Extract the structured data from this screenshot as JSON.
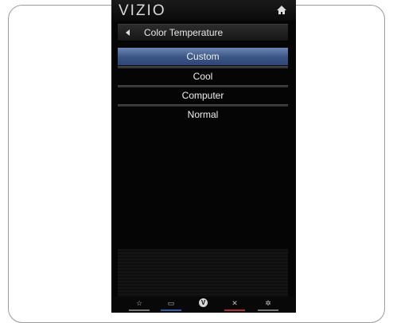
{
  "app": {
    "logo": "VIZIO"
  },
  "menu": {
    "title": "Color Temperature",
    "items": [
      {
        "label": "Custom",
        "selected": true
      },
      {
        "label": "Cool",
        "selected": false
      },
      {
        "label": "Computer",
        "selected": false
      },
      {
        "label": "Normal",
        "selected": false
      }
    ]
  },
  "bottom_nav": [
    {
      "icon": "star-icon",
      "glyph": "☆",
      "color": "#777777"
    },
    {
      "icon": "closed-caption-icon",
      "glyph": "▭",
      "color": "#2f5fb0"
    },
    {
      "icon": "v-button-icon",
      "glyph": "V",
      "color": "#d8d8d8"
    },
    {
      "icon": "close-icon",
      "glyph": "✕",
      "color": "#b03030"
    },
    {
      "icon": "gear-icon",
      "glyph": "✲",
      "color": "#777777"
    }
  ],
  "colors": {
    "selection": "#3a5585",
    "background": "#050505"
  }
}
